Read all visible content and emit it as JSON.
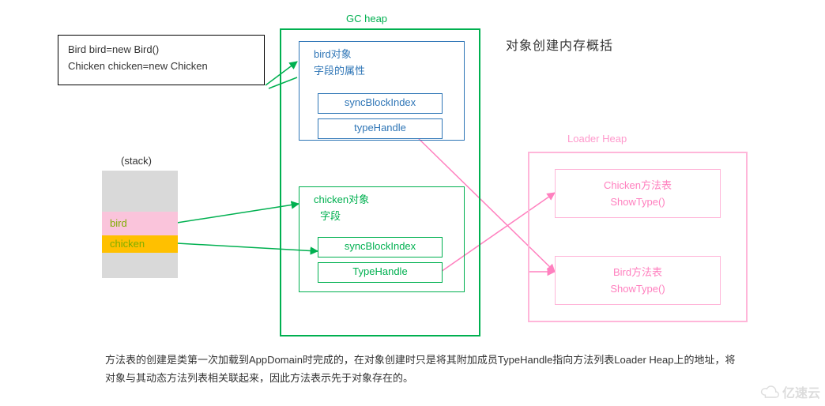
{
  "title": "对象创建内存概括",
  "code": {
    "line1": "Bird bird=new Bird()",
    "line2": "Chicken chicken=new Chicken"
  },
  "stack": {
    "label": "(stack)",
    "bird": "bird",
    "chicken": "chicken"
  },
  "gc_heap": {
    "label": "GC heap",
    "bird_obj": {
      "title": "bird对象",
      "sub": "字段的属性",
      "sync": "syncBlockIndex",
      "th": "typeHandle"
    },
    "chicken_obj": {
      "title": "chicken对象",
      "sub": "字段",
      "sync": "syncBlockIndex",
      "th": "TypeHandle"
    }
  },
  "loader_heap": {
    "label": "Loader Heap",
    "chicken_mt": {
      "title": "Chicken方法表",
      "method": "ShowType()"
    },
    "bird_mt": {
      "title": "Bird方法表",
      "method": "ShowType()"
    }
  },
  "footer": "方法表的创建是类第一次加载到AppDomain时完成的，在对象创建时只是将其附加成员TypeHandle指向方法列表Loader Heap上的地址，将对象与其动态方法列表相关联起来，因此方法表示先于对象存在的。",
  "watermark": "亿速云"
}
